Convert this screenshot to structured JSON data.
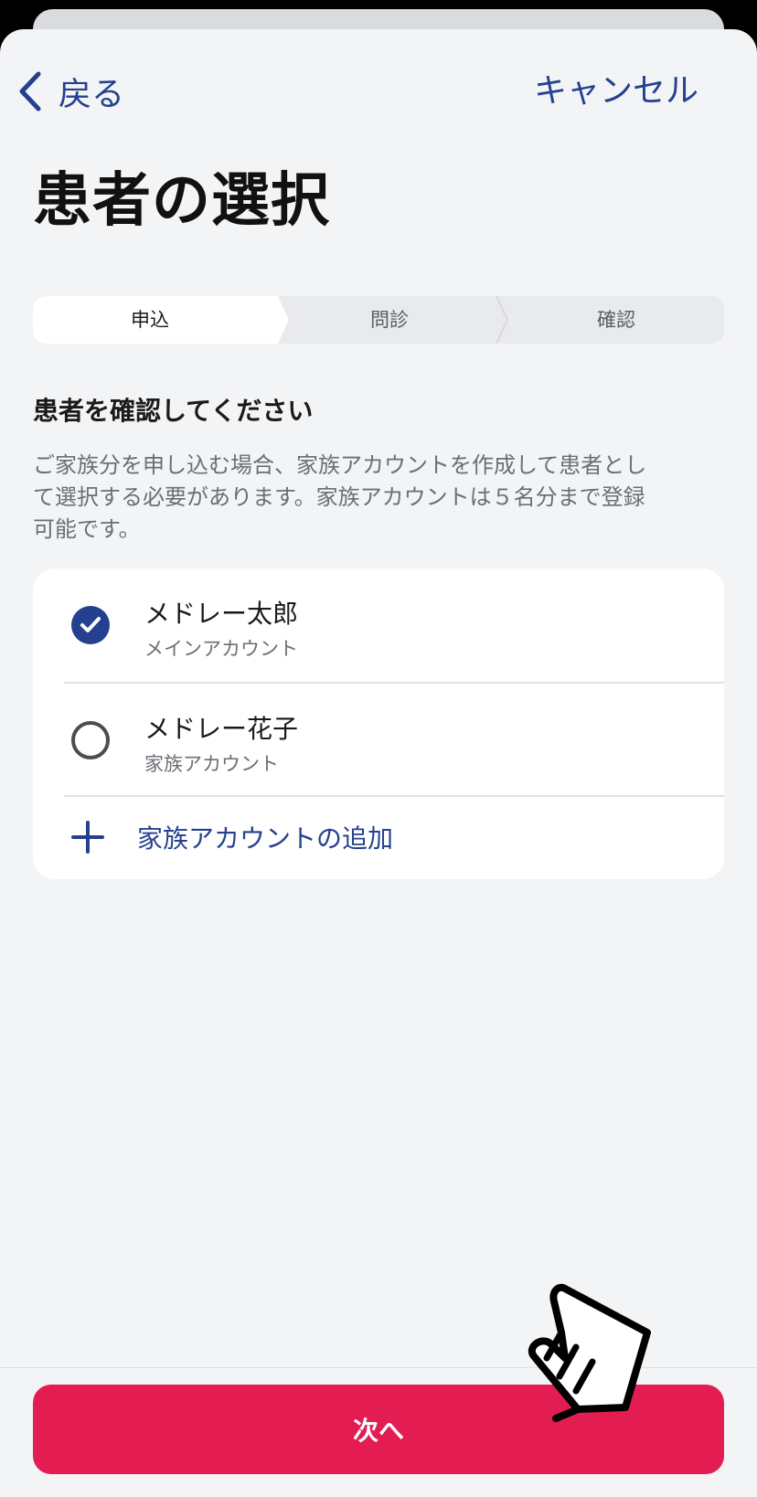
{
  "nav": {
    "back_label": "戻る",
    "cancel_label": "キャンセル"
  },
  "page": {
    "title": "患者の選択"
  },
  "stepper": {
    "steps": [
      {
        "label": "申込",
        "active": true
      },
      {
        "label": "問診",
        "active": false
      },
      {
        "label": "確認",
        "active": false
      }
    ]
  },
  "section": {
    "heading": "患者を確認してください",
    "description": "ご家族分を申し込む場合、家族アカウントを作成して患者として選択する必要があります。家族アカウントは５名分まで登録可能です。"
  },
  "patients": [
    {
      "name": "メドレー太郎",
      "account_type": "メインアカウント",
      "selected": true
    },
    {
      "name": "メドレー花子",
      "account_type": "家族アカウント",
      "selected": false
    }
  ],
  "add_family": {
    "label": "家族アカウントの追加",
    "icon": "plus-icon"
  },
  "footer": {
    "next_label": "次へ"
  },
  "colors": {
    "accent": "#25408f",
    "primary_button": "#e31c52",
    "background": "#f3f4f6"
  },
  "icons": {
    "back": "chevron-left-icon",
    "check": "check-icon",
    "pointer": "pointing-hand-icon"
  }
}
